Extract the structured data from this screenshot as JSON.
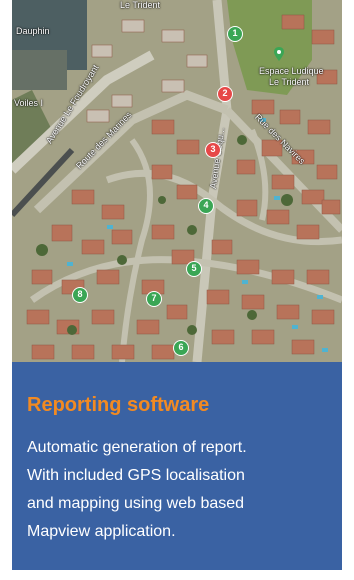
{
  "map": {
    "labels": {
      "le_trident_top": "Le Trident",
      "dauphin": "Dauphin",
      "voiles": "Voiles I",
      "avenue_foudroyant": "Avenue Le Foudroyant",
      "route_marines": "Route des Marines",
      "avenue_coqu": "Avenue Coqu...",
      "rue_navires": "Rue des Navires",
      "park_line1": "Espace Ludique",
      "park_line2": "Le Trident"
    },
    "markers": [
      {
        "num": "1",
        "color": "#3aa655"
      },
      {
        "num": "2",
        "color": "#e64848"
      },
      {
        "num": "3",
        "color": "#e64848"
      },
      {
        "num": "4",
        "color": "#3aa655"
      },
      {
        "num": "5",
        "color": "#3aa655"
      },
      {
        "num": "6",
        "color": "#3aa655"
      },
      {
        "num": "7",
        "color": "#3aa655"
      },
      {
        "num": "8",
        "color": "#3aa655"
      }
    ],
    "icons": [
      "park-marker-icon"
    ]
  },
  "card": {
    "title": "Reporting software",
    "description_lines": [
      "Automatic generation of report.",
      "With included GPS localisation",
      "and mapping using web based",
      "Mapview application."
    ]
  },
  "colors": {
    "panel": "#3a62a3",
    "title": "#f28a22",
    "marker_green": "#3aa655",
    "marker_red": "#e64848"
  }
}
